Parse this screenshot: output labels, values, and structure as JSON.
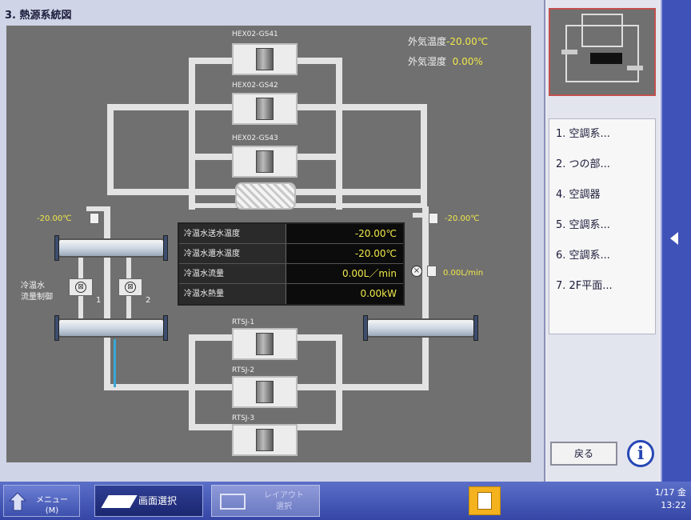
{
  "title": "3. 熱源系統図",
  "outdoor": {
    "temp_label": "外気温度",
    "temp_value": "-20.00℃",
    "humidity_label": "外気湿度",
    "humidity_value": "0.00%"
  },
  "units": {
    "heat_exchangers": [
      "HEX02-GS41",
      "HEX02-GS42",
      "HEX02-GS43"
    ],
    "pumps": [
      "RTSJ-1",
      "RTSJ-2",
      "RTSJ-3"
    ]
  },
  "sensors": {
    "left_temp": "-20.00℃",
    "right_temp": "-20.00℃",
    "flow": "0.00L/min"
  },
  "valves": {
    "label_line1": "冷温水",
    "label_line2": "流量制御",
    "v1": "1",
    "v2": "2"
  },
  "data_table": [
    {
      "label": "冷温水送水温度",
      "value": "-20.00℃"
    },
    {
      "label": "冷温水還水温度",
      "value": "-20.00℃"
    },
    {
      "label": "冷温水流量",
      "value": "0.00L／min"
    },
    {
      "label": "冷温水熱量",
      "value": "0.00kW"
    }
  ],
  "nav_items": [
    "1. 空調系...",
    "2. つの部...",
    "4. 空調器",
    "5. 空調系...",
    "6. 空調系...",
    "7. 2F平面..."
  ],
  "back_label": "戻る",
  "info_label": "i",
  "taskbar": {
    "menu_label_1": "メニュー",
    "menu_label_2": "(M)",
    "screen_select_label": "画面選択",
    "layout_label_1": "レイアウト",
    "layout_label_2": "選択",
    "date": "1/17 金",
    "time": "13:22"
  },
  "colors": {
    "diagram_bg": "#707070",
    "pipe": "#e3e3e3",
    "value_text": "#f0e84a",
    "accent_blue": "#3f52b8",
    "alarm": "#f3b21e"
  }
}
